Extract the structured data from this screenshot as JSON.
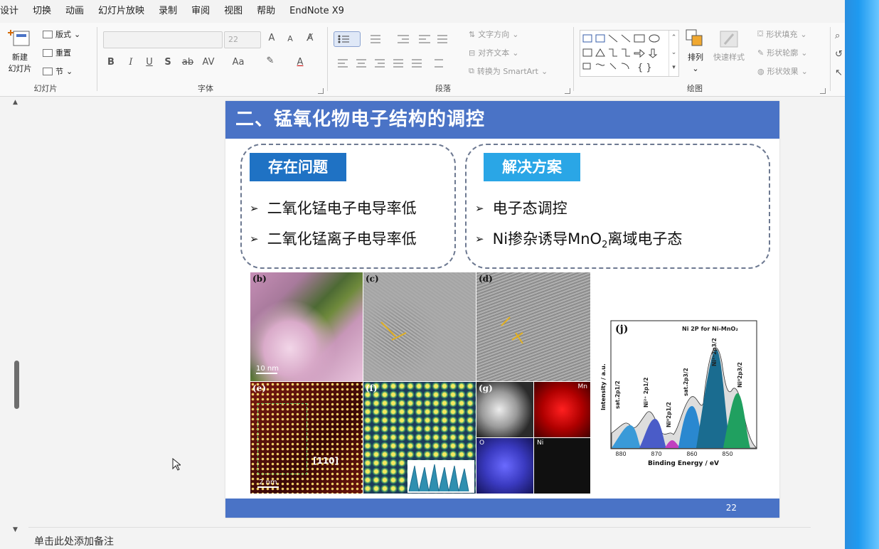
{
  "menu": [
    "设计",
    "切换",
    "动画",
    "幻灯片放映",
    "录制",
    "审阅",
    "视图",
    "帮助",
    "EndNote X9"
  ],
  "ribbon": {
    "slides": {
      "new_slide_line1": "新建",
      "new_slide_line2": "幻灯片",
      "layout": "版式",
      "reset": "重置",
      "section": "节",
      "label": "幻灯片"
    },
    "font": {
      "font_size": "22",
      "label": "字体",
      "bold": "B",
      "italic": "I",
      "underline": "U",
      "shadow": "S",
      "strike": "ab",
      "spacing": "AV",
      "case": "Aa",
      "grow": "A",
      "shrink": "A"
    },
    "paragraph": {
      "text_direction": "文字方向",
      "align_text": "对齐文本",
      "convert_smartart": "转换为 SmartArt",
      "label": "段落"
    },
    "drawing": {
      "arrange": "排列",
      "quick_styles": "快速样式",
      "shape_fill": "形状填充",
      "shape_outline": "形状轮廓",
      "shape_effects": "形状效果",
      "label": "绘图"
    }
  },
  "slide": {
    "title": "二、锰氧化物电子结构的调控",
    "problems": {
      "tag": "存在问题",
      "items": [
        "二氧化锰电子电导率低",
        "二氧化锰离子电导率低"
      ]
    },
    "solutions": {
      "tag": "解决方案",
      "items": [
        "电子态调控"
      ],
      "item2_prefix": "Ni掺杂诱导MnO",
      "item2_sub": "2",
      "item2_suffix": "离域电子态"
    },
    "panels": {
      "b": "(b)",
      "c": "(c)",
      "d": "(d)",
      "e": "(e)",
      "f": "(f)",
      "g": "(g)",
      "j": "(j)",
      "scale_b": "10 nm",
      "scale_e": "2 nm",
      "miller": "[110]",
      "g_mn": "Mn",
      "g_o": "O",
      "g_ni": "Ni"
    },
    "xps": {
      "title": "Ni 2P for Ni-MnO₂",
      "xlabel": "Binding Energy / eV",
      "ylabel": "Intensity / a.u.",
      "ticks": [
        "880",
        "870",
        "860",
        "850"
      ],
      "peaks": [
        "sat.2p1/2",
        "Ni²⁺ 2p1/2",
        "Ni⁰2p1/2",
        "sat.2p3/2",
        "Ni²⁺2p3/2",
        "Ni⁰2p3/2"
      ]
    },
    "page_number": "22"
  },
  "notes": "单击此处添加备注",
  "colors": {
    "accent": "#4a73c6",
    "tag_problem": "#1f72c4",
    "tag_solution": "#2aa6e6"
  }
}
